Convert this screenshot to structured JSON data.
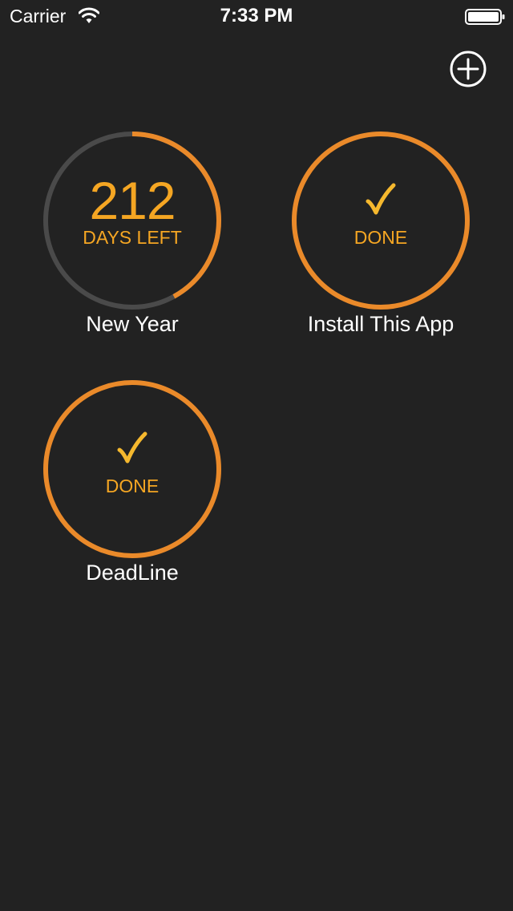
{
  "status_bar": {
    "carrier": "Carrier",
    "time": "7:33 PM"
  },
  "actions": {
    "add_icon": "plus-circle-icon"
  },
  "colors": {
    "background": "#222222",
    "accent": "#ea8a2a",
    "text_accent": "#f5a623",
    "track": "#4a4a4a"
  },
  "timers": [
    {
      "name": "New Year",
      "value": "212",
      "caption": "DAYS LEFT",
      "progress": 0.42
    },
    {
      "name": "Install This App",
      "caption": "DONE",
      "status": "done"
    },
    {
      "name": "DeadLine",
      "caption": "DONE",
      "status": "done"
    }
  ]
}
